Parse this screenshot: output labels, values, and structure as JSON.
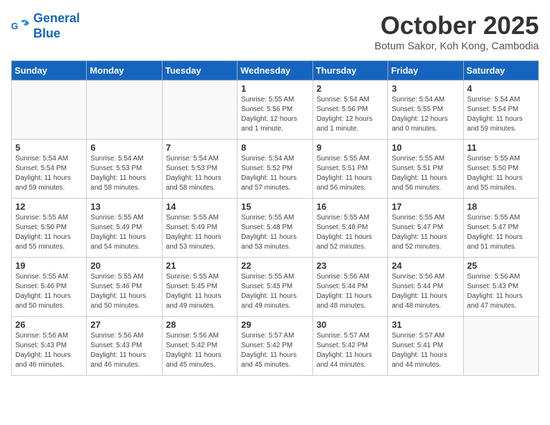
{
  "header": {
    "logo_line1": "General",
    "logo_line2": "Blue",
    "month_title": "October 2025",
    "subtitle": "Botum Sakor, Koh Kong, Cambodia"
  },
  "weekdays": [
    "Sunday",
    "Monday",
    "Tuesday",
    "Wednesday",
    "Thursday",
    "Friday",
    "Saturday"
  ],
  "weeks": [
    [
      {
        "day": "",
        "detail": ""
      },
      {
        "day": "",
        "detail": ""
      },
      {
        "day": "",
        "detail": ""
      },
      {
        "day": "1",
        "detail": "Sunrise: 5:55 AM\nSunset: 5:56 PM\nDaylight: 12 hours\nand 1 minute."
      },
      {
        "day": "2",
        "detail": "Sunrise: 5:54 AM\nSunset: 5:56 PM\nDaylight: 12 hours\nand 1 minute."
      },
      {
        "day": "3",
        "detail": "Sunrise: 5:54 AM\nSunset: 5:55 PM\nDaylight: 12 hours\nand 0 minutes."
      },
      {
        "day": "4",
        "detail": "Sunrise: 5:54 AM\nSunset: 5:54 PM\nDaylight: 11 hours\nand 59 minutes."
      }
    ],
    [
      {
        "day": "5",
        "detail": "Sunrise: 5:54 AM\nSunset: 5:54 PM\nDaylight: 11 hours\nand 59 minutes."
      },
      {
        "day": "6",
        "detail": "Sunrise: 5:54 AM\nSunset: 5:53 PM\nDaylight: 11 hours\nand 58 minutes."
      },
      {
        "day": "7",
        "detail": "Sunrise: 5:54 AM\nSunset: 5:53 PM\nDaylight: 11 hours\nand 58 minutes."
      },
      {
        "day": "8",
        "detail": "Sunrise: 5:54 AM\nSunset: 5:52 PM\nDaylight: 11 hours\nand 57 minutes."
      },
      {
        "day": "9",
        "detail": "Sunrise: 5:55 AM\nSunset: 5:51 PM\nDaylight: 11 hours\nand 56 minutes."
      },
      {
        "day": "10",
        "detail": "Sunrise: 5:55 AM\nSunset: 5:51 PM\nDaylight: 11 hours\nand 56 minutes."
      },
      {
        "day": "11",
        "detail": "Sunrise: 5:55 AM\nSunset: 5:50 PM\nDaylight: 11 hours\nand 55 minutes."
      }
    ],
    [
      {
        "day": "12",
        "detail": "Sunrise: 5:55 AM\nSunset: 5:50 PM\nDaylight: 11 hours\nand 55 minutes."
      },
      {
        "day": "13",
        "detail": "Sunrise: 5:55 AM\nSunset: 5:49 PM\nDaylight: 11 hours\nand 54 minutes."
      },
      {
        "day": "14",
        "detail": "Sunrise: 5:55 AM\nSunset: 5:49 PM\nDaylight: 11 hours\nand 53 minutes."
      },
      {
        "day": "15",
        "detail": "Sunrise: 5:55 AM\nSunset: 5:48 PM\nDaylight: 11 hours\nand 53 minutes."
      },
      {
        "day": "16",
        "detail": "Sunrise: 5:55 AM\nSunset: 5:48 PM\nDaylight: 11 hours\nand 52 minutes."
      },
      {
        "day": "17",
        "detail": "Sunrise: 5:55 AM\nSunset: 5:47 PM\nDaylight: 11 hours\nand 52 minutes."
      },
      {
        "day": "18",
        "detail": "Sunrise: 5:55 AM\nSunset: 5:47 PM\nDaylight: 11 hours\nand 51 minutes."
      }
    ],
    [
      {
        "day": "19",
        "detail": "Sunrise: 5:55 AM\nSunset: 5:46 PM\nDaylight: 11 hours\nand 50 minutes."
      },
      {
        "day": "20",
        "detail": "Sunrise: 5:55 AM\nSunset: 5:46 PM\nDaylight: 11 hours\nand 50 minutes."
      },
      {
        "day": "21",
        "detail": "Sunrise: 5:55 AM\nSunset: 5:45 PM\nDaylight: 11 hours\nand 49 minutes."
      },
      {
        "day": "22",
        "detail": "Sunrise: 5:55 AM\nSunset: 5:45 PM\nDaylight: 11 hours\nand 49 minutes."
      },
      {
        "day": "23",
        "detail": "Sunrise: 5:56 AM\nSunset: 5:44 PM\nDaylight: 11 hours\nand 48 minutes."
      },
      {
        "day": "24",
        "detail": "Sunrise: 5:56 AM\nSunset: 5:44 PM\nDaylight: 11 hours\nand 48 minutes."
      },
      {
        "day": "25",
        "detail": "Sunrise: 5:56 AM\nSunset: 5:43 PM\nDaylight: 11 hours\nand 47 minutes."
      }
    ],
    [
      {
        "day": "26",
        "detail": "Sunrise: 5:56 AM\nSunset: 5:43 PM\nDaylight: 11 hours\nand 46 minutes."
      },
      {
        "day": "27",
        "detail": "Sunrise: 5:56 AM\nSunset: 5:43 PM\nDaylight: 11 hours\nand 46 minutes."
      },
      {
        "day": "28",
        "detail": "Sunrise: 5:56 AM\nSunset: 5:42 PM\nDaylight: 11 hours\nand 45 minutes."
      },
      {
        "day": "29",
        "detail": "Sunrise: 5:57 AM\nSunset: 5:42 PM\nDaylight: 11 hours\nand 45 minutes."
      },
      {
        "day": "30",
        "detail": "Sunrise: 5:57 AM\nSunset: 5:42 PM\nDaylight: 11 hours\nand 44 minutes."
      },
      {
        "day": "31",
        "detail": "Sunrise: 5:57 AM\nSunset: 5:41 PM\nDaylight: 11 hours\nand 44 minutes."
      },
      {
        "day": "",
        "detail": ""
      }
    ]
  ]
}
